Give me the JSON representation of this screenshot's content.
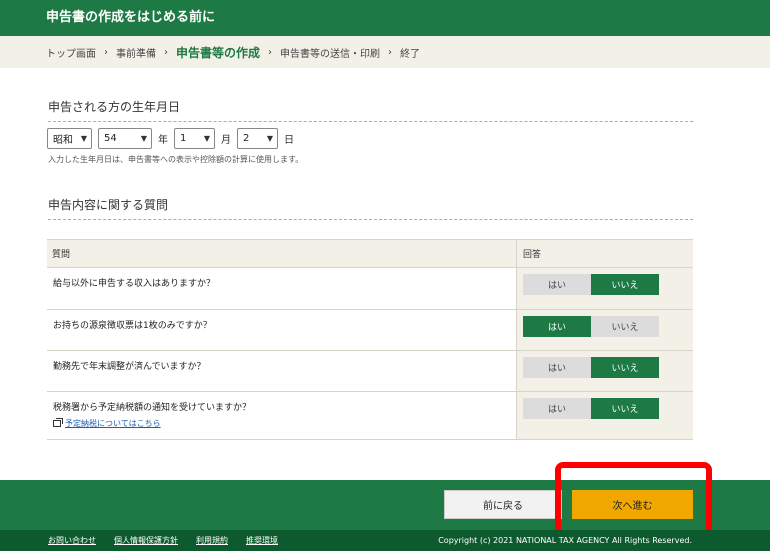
{
  "header": {
    "title": "申告書の作成をはじめる前に"
  },
  "breadcrumb": {
    "steps": [
      "トップ画面",
      "事前準備",
      "申告書等の作成",
      "申告書等の送信・印刷",
      "終了"
    ],
    "separator": "›"
  },
  "dob": {
    "section_title": "申告される方の生年月日",
    "era": "昭和",
    "year": "54",
    "year_unit": "年",
    "month": "1",
    "month_unit": "月",
    "day": "2",
    "day_unit": "日",
    "note": "入力した生年月日は、申告書等への表示や控除額の計算に使用します。"
  },
  "questions": {
    "section_title": "申告内容に関する質問",
    "header_question": "質問",
    "header_answer": "回答",
    "yes_label": "はい",
    "no_label": "いいえ",
    "items": [
      {
        "text": "給与以外に申告する収入はありますか？",
        "answer": "no"
      },
      {
        "text": "お持ちの源泉徴収票は1枚のみですか？",
        "answer": "yes"
      },
      {
        "text": "勤務先で年末調整が済んでいますか？",
        "answer": "no"
      },
      {
        "text": "税務署から予定納税額の通知を受けていますか？",
        "answer": "no",
        "link": "予定納税についてはこちら"
      }
    ]
  },
  "nav": {
    "back_label": "前に戻る",
    "next_label": "次へ進む"
  },
  "footer": {
    "links": [
      "お問い合わせ",
      "個人情報保護方針",
      "利用規約",
      "推奨環境"
    ],
    "copyright": "Copyright (c) 2021 NATIONAL TAX AGENCY All Rights Reserved."
  },
  "colors": {
    "primary_green": "#1e7a45",
    "accent_orange": "#f0a800",
    "highlight_red": "#ff0000"
  }
}
